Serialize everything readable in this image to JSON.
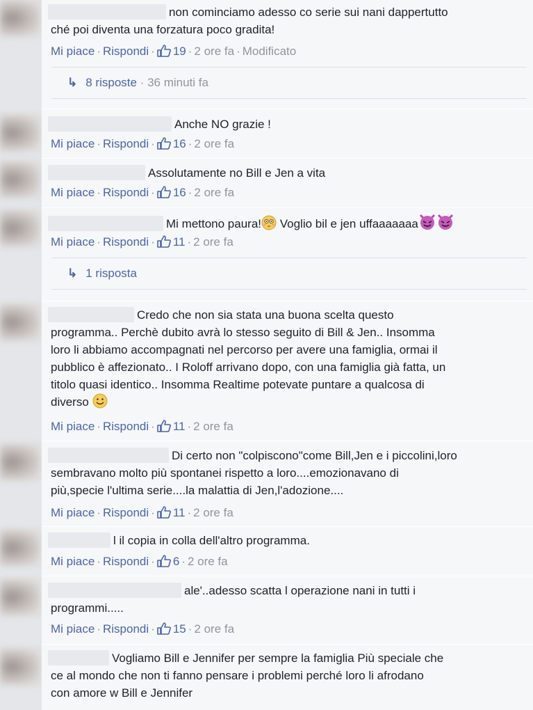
{
  "actions": {
    "like": "Mi piace",
    "reply": "Rispondi",
    "edited": "Modificato"
  },
  "comments": [
    {
      "text": "non cominciamo adesso co serie sui nani dappertutto\nché poi diventa una forzatura poco gradita!",
      "likes": "19",
      "time": "2 ore fa",
      "edited": true,
      "replies": {
        "label": "8 risposte",
        "time": "36 minuti fa"
      }
    },
    {
      "text": "Anche NO grazie !",
      "likes": "16",
      "time": "2 ore fa"
    },
    {
      "text": "Assolutamente no Bill e Jen a vita",
      "likes": "16",
      "time": "2 ore fa"
    },
    {
      "text": "Mi mettono paura!",
      "text2": " Voglio bil e jen uffaaaaaaa",
      "likes": "11",
      "time": "2 ore fa",
      "replies": {
        "label": "1 risposta"
      }
    },
    {
      "text": "Credo che non sia stata una buona scelta questo\nprogramma.. Perchè dubito avrà lo stesso seguito di Bill & Jen.. Insomma\nloro li abbiamo accompagnati nel percorso per avere una famiglia, ormai il\npubblico è affezionato.. I Roloff arrivano dopo, con una famiglia già fatta, un\ntitolo quasi identico.. Insomma Realtime potevate puntare a qualcosa di\ndiverso ",
      "likes": "11",
      "time": "2 ore fa"
    },
    {
      "text": "Di certo non \"colpiscono\"come Bill,Jen e i piccolini,loro\nsembravano molto più spontanei rispetto a loro....emozionavano di\npiù,specie l'ultima serie....la malattia di Jen,l'adozione....",
      "likes": "11",
      "time": "2 ore fa"
    },
    {
      "text": "l il copia in colla dell'altro programma.",
      "likes": "6",
      "time": "2 ore fa"
    },
    {
      "text": "ale'..adesso scatta l operazione nani in tutti i\nprogrammi.....",
      "likes": "15",
      "time": "2 ore fa"
    },
    {
      "text": "Vogliamo Bill e Jennifer per sempre la famiglia Più speciale che\nce al mondo che non ti fanno pensare i problemi perché loro li afrodano\ncon amore w Bill e Jennifer"
    }
  ],
  "colors": {
    "link": "#4b67a1",
    "meta": "#90949c",
    "bg": "#f6f7f9",
    "text": "#1d2129"
  }
}
